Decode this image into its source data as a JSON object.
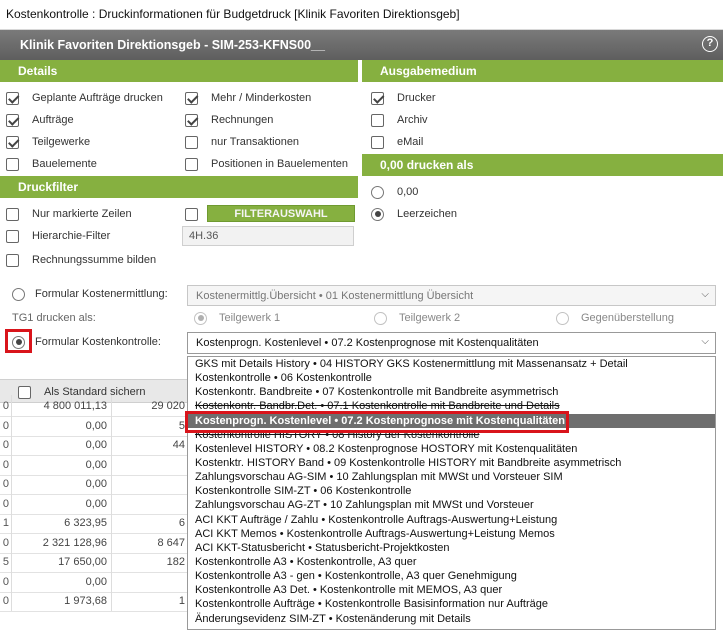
{
  "window_title": "Kostenkontrolle : Druckinformationen für Budgetdruck [Klinik Favoriten Direktionsgeb]",
  "header": {
    "title": "Klinik Favoriten Direktionsgeb - SIM-253-KFNS00__",
    "help": "?"
  },
  "details": {
    "title": "Details",
    "items": [
      {
        "label": "Geplante Aufträge drucken",
        "checked": true
      },
      {
        "label": "Mehr / Minderkosten",
        "checked": true
      },
      {
        "label": "Aufträge",
        "checked": true
      },
      {
        "label": "Rechnungen",
        "checked": true
      },
      {
        "label": "Teilgewerke",
        "checked": true
      },
      {
        "label": "nur Transaktionen",
        "checked": false
      },
      {
        "label": "Bauelemente",
        "checked": false
      },
      {
        "label": "Positionen in Bauelementen",
        "checked": false
      }
    ]
  },
  "ausgabe": {
    "title": "Ausgabemedium",
    "items": [
      {
        "label": "Drucker",
        "checked": true
      },
      {
        "label": "Archiv",
        "checked": false
      },
      {
        "label": "eMail",
        "checked": false
      }
    ]
  },
  "nulldruck": {
    "title": "0,00 drucken als",
    "options": [
      {
        "label": "0,00",
        "selected": false
      },
      {
        "label": "Leerzeichen",
        "selected": true
      }
    ]
  },
  "druckfilter": {
    "title": "Druckfilter",
    "nur_markierte": "Nur markierte Zeilen",
    "filter_button": "FILTERAUSWAHL",
    "hierarchie": "Hierarchie-Filter",
    "hierarchie_value": "4H.36",
    "rechnungssumme": "Rechnungssumme bilden"
  },
  "formular_ermittlung": {
    "label": "Formular Kostenermittlung:",
    "value": "Kostenermittlg.Übersicht • 01 Kostenermittlung Übersicht"
  },
  "tg1": {
    "label": "TG1 drucken als:",
    "options": [
      "Teilgewerk 1",
      "Teilgewerk 2",
      "Gegenüberstellung"
    ]
  },
  "formular_kontrolle": {
    "label": "Formular Kostenkontrolle:",
    "value": "Kostenprogn. Kostenlevel • 07.2 Kostenprognose mit Kostenqualitäten"
  },
  "als_standard": "Als Standard sichern",
  "dropdown_items": [
    "GKS mit Details History • 04 HISTORY GKS Kostenermittlung mit Massenansatz + Detail",
    "Kostenkontrolle • 06 Kostenkontrolle",
    "Kostenkontr. Bandbreite • 07 Kostenkontrolle mit Bandbreite asymmetrisch",
    "Kostenkontr. Bandbr.Det. • 07.1 Kostenkontrolle mit Bandbreite und Details",
    "Kostenprogn. Kostenlevel • 07.2 Kostenprognose mit Kostenqualitäten",
    "Kostenkontrolle HISTORY • 08 History der Kostenkontrolle",
    "Kostenlevel HISTORY • 08.2 Kostenprognose HOSTORY mit Kostenqualitäten",
    "Kostenktr. HISTORY Band • 09 Kostenkontrolle HISTORY mit Bandbreite asymmetrisch",
    "Zahlungsvorschau AG-SIM • 10 Zahlungsplan mit MWSt und Vorsteuer SIM",
    "Kostenkontrolle SIM-ZT • 06 Kostenkontrolle",
    "Zahlungsvorschau AG-ZT • 10 Zahlungsplan mit MWSt und Vorsteuer",
    "ACI KKT Aufträge / Zahlu • Kostenkontrolle Auftrags-Auswertung+Leistung",
    "ACI KKT Memos • Kostenkontrolle Auftrags-Auswertung+Leistung Memos",
    "ACI KKT-Statusbericht • Statusbericht-Projektkosten",
    "Kostenkontrolle A3 • Kostenkontrolle, A3 quer",
    "Kostenkontrolle A3 - gen • Kostenkontrolle, A3 quer Genehmigung",
    "Kostenkontrolle A3 Det. • Kostenkontrolle mit MEMOS, A3 quer",
    "Kostenkontrolle Aufträge • Kostenkontrolle Basisinformation nur Aufträge",
    "Änderungsevidenz SIM-ZT • Kostenänderung mit Details"
  ],
  "grid_rows": [
    {
      "c0": "0",
      "c1": "4 800 011,13",
      "c2": "29 020"
    },
    {
      "c0": "0",
      "c1": "0,00",
      "c2": "5"
    },
    {
      "c0": "0",
      "c1": "0,00",
      "c2": "44"
    },
    {
      "c0": "0",
      "c1": "0,00",
      "c2": ""
    },
    {
      "c0": "0",
      "c1": "0,00",
      "c2": ""
    },
    {
      "c0": "0",
      "c1": "0,00",
      "c2": ""
    },
    {
      "c0": "1",
      "c1": "6 323,95",
      "c2": "6"
    },
    {
      "c0": "0",
      "c1": "2 321 128,96",
      "c2": "8 647"
    },
    {
      "c0": "5",
      "c1": "17 650,00",
      "c2": "182"
    },
    {
      "c0": "0",
      "c1": "0,00",
      "c2": ""
    },
    {
      "c0": "0",
      "c1": "1 973,68",
      "c2": "1"
    }
  ],
  "colors": {
    "accent_green": "#86b040",
    "header_gray": "#666666",
    "highlight_red": "#d9141b",
    "selected_item": "#6e6e6e"
  }
}
